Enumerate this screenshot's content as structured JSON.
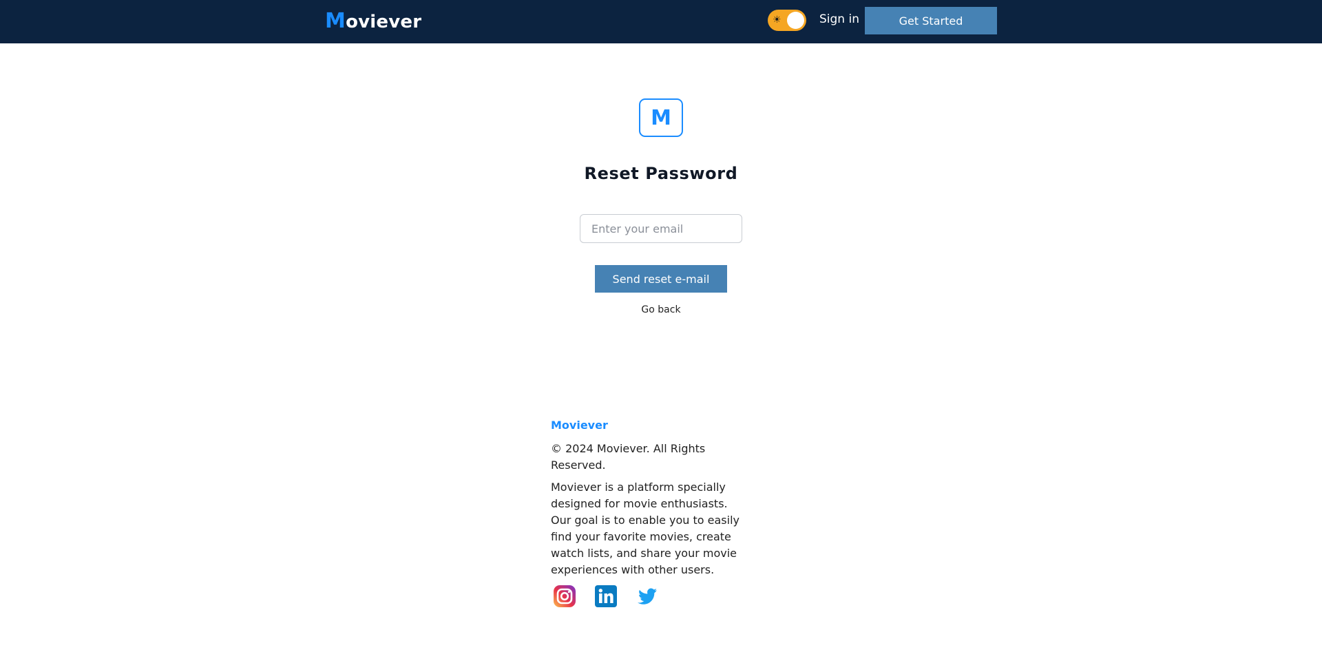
{
  "header": {
    "logo_initial": "M",
    "logo_rest": "oviever",
    "theme_toggle_icon": "☀",
    "sign_in_label": "Sign in",
    "get_started_label": "Get Started"
  },
  "main": {
    "badge_letter": "M",
    "title": "Reset Password",
    "email_placeholder": "Enter your email",
    "email_value": "",
    "send_button_label": "Send reset e-mail",
    "go_back_label": "Go back"
  },
  "footer": {
    "brand": "Moviever",
    "copyright": "© 2024 Moviever. All Rights Reserved.",
    "description": "Moviever is a platform specially designed for movie enthusiasts. Our goal is to enable you to easily find your favorite movies, create watch lists, and share your movie experiences with other users.",
    "socials": [
      {
        "name": "instagram-icon"
      },
      {
        "name": "linkedin-icon"
      },
      {
        "name": "twitter-icon"
      }
    ]
  },
  "colors": {
    "header_bg": "#0c2340",
    "accent": "#1a8cff",
    "button": "#4682b4",
    "toggle": "#f5a623"
  }
}
